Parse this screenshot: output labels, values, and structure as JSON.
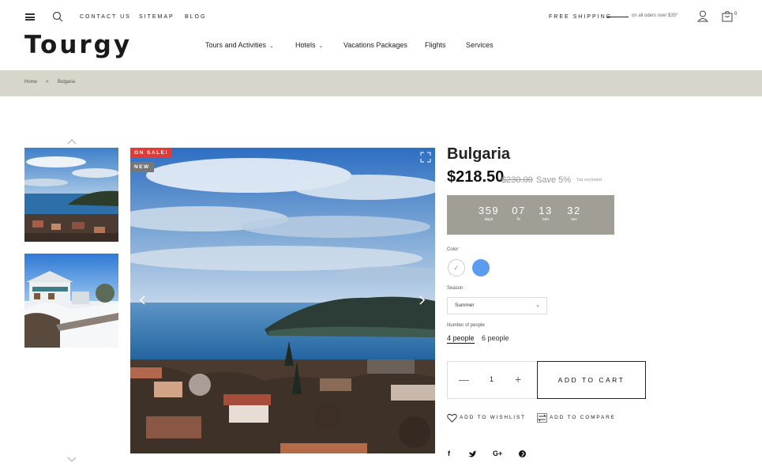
{
  "topbar": {
    "links": [
      "CONTACT US",
      "SITEMAP",
      "BLOG"
    ],
    "shipping_label": "FREE SHIPPING",
    "shipping_note": "on all oders over $35*",
    "cart_count": "0"
  },
  "logo": {
    "text": "Tourgy"
  },
  "nav": {
    "items": [
      {
        "label": "Tours and Activities",
        "has_dropdown": true
      },
      {
        "label": "Hotels",
        "has_dropdown": true
      },
      {
        "label": "Vacations Packages",
        "has_dropdown": false
      },
      {
        "label": "Flights",
        "has_dropdown": false
      },
      {
        "label": "Services",
        "has_dropdown": false
      }
    ]
  },
  "breadcrumb": {
    "home": "Home",
    "sep": ">",
    "current": "Bulgaria"
  },
  "badges": {
    "sale": "ON SALE!",
    "new": "NEW"
  },
  "product": {
    "title": "Bulgaria",
    "price": "$218.50",
    "old_price": "$230.00",
    "save": "Save 5%",
    "tax": "Tax excluded"
  },
  "countdown": {
    "days": "359",
    "days_label": "days",
    "hours": "07",
    "hours_label": "hr",
    "minutes": "13",
    "minutes_label": "min",
    "seconds": "32",
    "seconds_label": "sec"
  },
  "options": {
    "color_label": "Color",
    "colors": [
      "#ffffff",
      "#5b9bf0"
    ],
    "season_label": "Season",
    "season_value": "Summer",
    "people_label": "Number of people",
    "people_selected": "4 people",
    "people_other": "6 people"
  },
  "purchase": {
    "quantity": "1",
    "add_to_cart": "ADD TO CART"
  },
  "actions": {
    "wishlist": "ADD TO WISHLIST",
    "compare": "ADD TO COMPARE"
  },
  "social": {
    "facebook": "f",
    "twitter": "twitter",
    "googleplus": "G+",
    "pinterest": "P"
  }
}
